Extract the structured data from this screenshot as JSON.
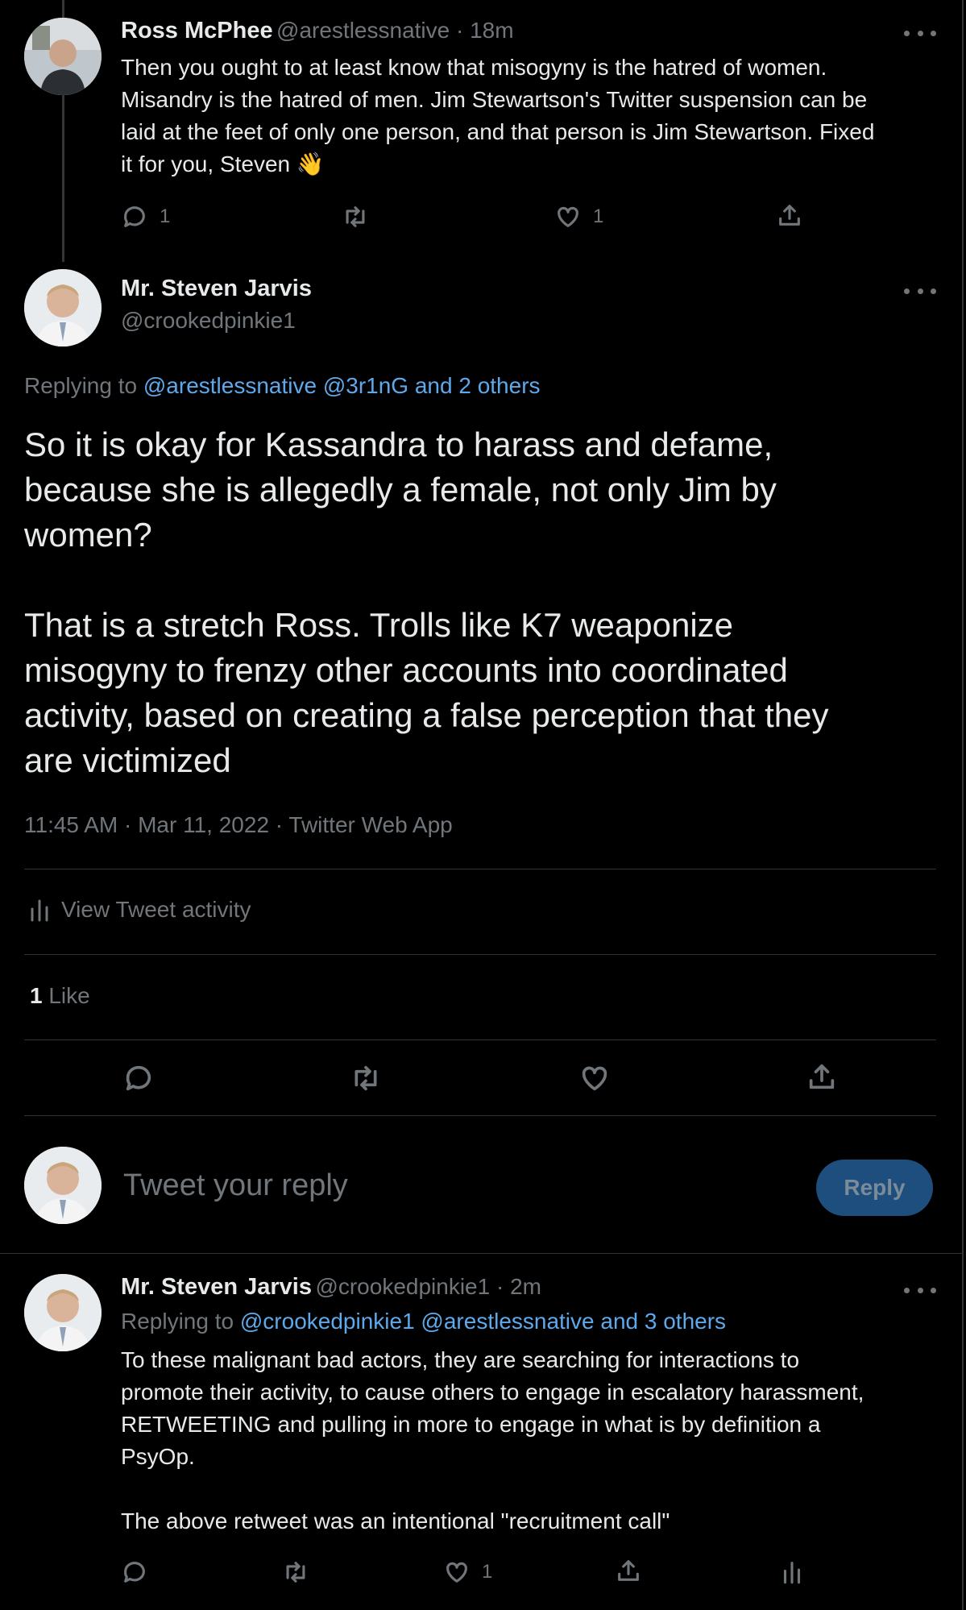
{
  "tweet1": {
    "name": "Ross McPhee",
    "meta": "@arestlessnative · 18m",
    "lines": [
      "Then you ought to at least know that misogyny is the hatred of women.",
      "Misandry is the hatred of men. Jim Stewartson's Twitter suspension can be",
      "laid at the feet of only one person, and that person is Jim Stewartson. Fixed",
      "it for you, Steven 👋"
    ],
    "reply_count": "1",
    "like_count": "1"
  },
  "main": {
    "name": "Mr. Steven Jarvis",
    "handle": "@crookedpinkie1",
    "replying_prefix": "Replying to ",
    "replying_links": "@arestlessnative @3r1nG and 2 others",
    "text_lines_a": [
      "So it is okay for Kassandra to harass and defame,",
      "because she is allegedly a female, not only Jim by",
      "women?"
    ],
    "text_lines_b": [
      "That is a stretch Ross. Trolls like K7 weaponize",
      "misogyny to frenzy other accounts into coordinated",
      "activity, based on creating a false perception that they",
      "are victimized"
    ],
    "timestamp": "11:45 AM · Mar 11, 2022 · Twitter Web App",
    "activity_label": "View Tweet activity",
    "like_num": "1",
    "like_label": " Like"
  },
  "reply_box": {
    "placeholder": "Tweet your reply",
    "button": "Reply"
  },
  "tweet3": {
    "name": "Mr. Steven Jarvis",
    "meta": "@crookedpinkie1 · 2m",
    "replying_prefix": "Replying to ",
    "replying_links": "@crookedpinkie1 @arestlessnative and 3 others",
    "lines": [
      "To these malignant bad actors, they are searching for interactions to",
      "promote their activity, to cause others to engage in escalatory harassment,",
      "RETWEETING and pulling in more to engage in what is by definition a",
      "PsyOp."
    ],
    "line_last": "The above retweet was an intentional \"recruitment call\"",
    "like_count": "1"
  },
  "colors": {
    "background": "#000000",
    "text": "#e7e9ea",
    "muted": "#71767b",
    "link": "#5ea9ec",
    "reply_button": "#1d4e7d"
  },
  "icons": [
    "more-icon",
    "reply-icon",
    "retweet-icon",
    "like-icon",
    "share-icon",
    "analytics-icon"
  ]
}
